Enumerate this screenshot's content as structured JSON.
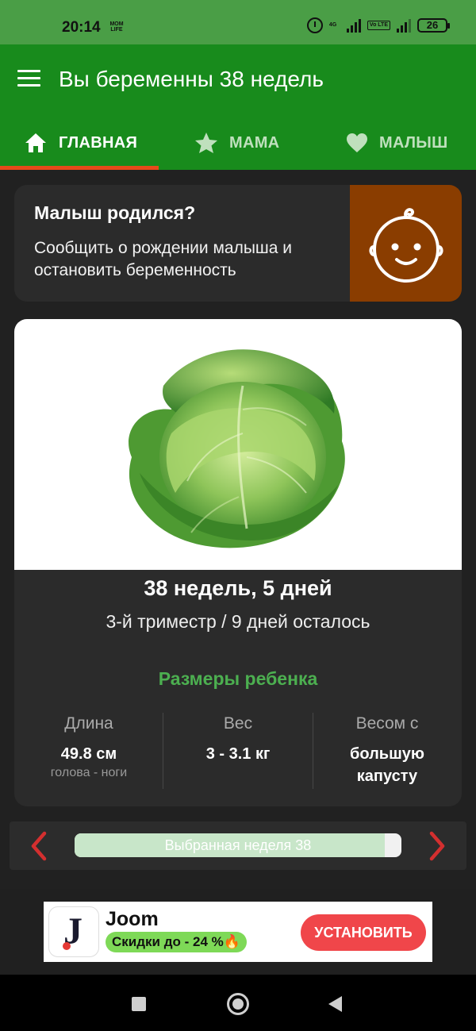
{
  "status_bar": {
    "time": "20:14",
    "carrier_logo_line1": "MOM",
    "carrier_logo_line2": "LIFE",
    "network_tag": "4G",
    "volte_tag": "Vo LTE",
    "battery": "26"
  },
  "app_bar": {
    "title": "Вы беременны 38 недель",
    "tabs": [
      {
        "label": "ГЛАВНАЯ",
        "icon": "home-icon",
        "selected": true
      },
      {
        "label": "МАМА",
        "icon": "star-icon",
        "selected": false
      },
      {
        "label": "МАЛЫШ",
        "icon": "heart-icon",
        "selected": false
      }
    ]
  },
  "baby_born_card": {
    "title": "Малыш родился?",
    "text": "Сообщить о рождении малыша и остановить беременность",
    "icon": "baby-face-icon"
  },
  "pregnancy_card": {
    "image": "cabbage-image",
    "weeks_days": "38 недель, 5 дней",
    "trimester_info": "3-й триместр / 9 дней осталось",
    "sizes_title": "Размеры ребенка",
    "stats": [
      {
        "label": "Длина",
        "value": "49.8 см",
        "sub": "голова - ноги"
      },
      {
        "label": "Вес",
        "value": "3 - 3.1 кг",
        "sub": ""
      },
      {
        "label": "Весом с",
        "value": "большую капусту",
        "sub": ""
      }
    ]
  },
  "week_selector": {
    "label": "Выбранная неделя 38",
    "progress_fraction": 0.95
  },
  "ad": {
    "app_name": "Joom",
    "logo_letter": "J",
    "promo": "Скидки до -  24  %🔥",
    "cta": "УСТАНОВИТЬ"
  },
  "colors": {
    "status_bar": "#4a9e46",
    "app_bar": "#188b1c",
    "tab_indicator": "#e64a19",
    "accent_green": "#4caf50",
    "baby_icon_bg": "#8a3d00",
    "nav_arrows": "#d32f2f",
    "ad_cta": "#f0464a"
  }
}
